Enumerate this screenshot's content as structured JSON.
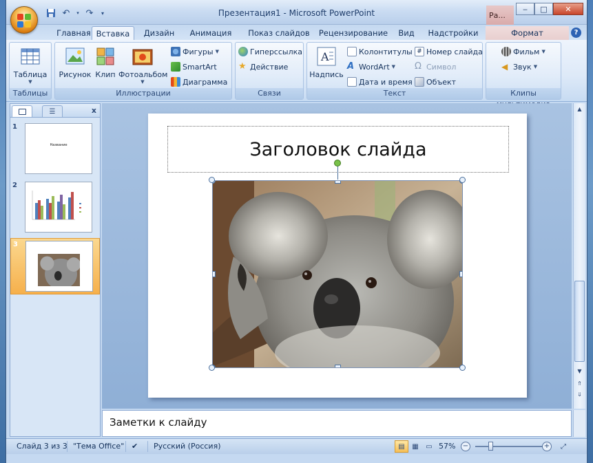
{
  "window": {
    "title": "Презентация1 - Microsoft PowerPoint",
    "context_title": "Ра...",
    "minimize": "‒",
    "maximize": "□",
    "close": "✕"
  },
  "tabs": [
    {
      "label": "Главная",
      "active": false
    },
    {
      "label": "Вставка",
      "active": true
    },
    {
      "label": "Дизайн",
      "active": false
    },
    {
      "label": "Анимация",
      "active": false
    },
    {
      "label": "Показ слайдов",
      "active": false
    },
    {
      "label": "Рецензирование",
      "active": false
    },
    {
      "label": "Вид",
      "active": false
    },
    {
      "label": "Надстройки",
      "active": false
    },
    {
      "label": "Формат",
      "active": false,
      "contextual": true
    }
  ],
  "help": "?",
  "ribbon": {
    "groups": {
      "tables": "Таблицы",
      "illustrations": "Иллюстрации",
      "links": "Связи",
      "text": "Текст",
      "media": "Клипы мультимедиа"
    },
    "buttons": {
      "table": "Таблица",
      "picture": "Рисунок",
      "clip": "Клип",
      "photo_album": "Фотоальбом",
      "shapes": "Фигуры",
      "smartart": "SmartArt",
      "chart": "Диаграмма",
      "hyperlink": "Гиперссылка",
      "action": "Действие",
      "textbox": "Надпись",
      "header_footer": "Колонтитулы",
      "wordart": "WordArt",
      "date_time": "Дата и время",
      "slide_number": "Номер слайда",
      "symbol": "Символ",
      "object": "Объект",
      "movie": "Фильм",
      "sound": "Звук"
    }
  },
  "left_panel": {
    "close": "x",
    "thumb1_title": "Название",
    "slides": [
      {
        "num": "1",
        "selected": false
      },
      {
        "num": "2",
        "selected": false
      },
      {
        "num": "3",
        "selected": true
      }
    ]
  },
  "slide": {
    "title": "Заголовок слайда"
  },
  "notes": {
    "text": "Заметки к слайду"
  },
  "status": {
    "slide_count": "Слайд 3 из 3",
    "theme": "\"Тема Office\"",
    "language": "Русский (Россия)",
    "zoom": "57%",
    "zoom_minus": "−",
    "zoom_plus": "+"
  },
  "colors": {
    "accent_orange": "#f6b04c",
    "ribbon_blue": "#c5d9f1",
    "title_text": "#15325b"
  }
}
